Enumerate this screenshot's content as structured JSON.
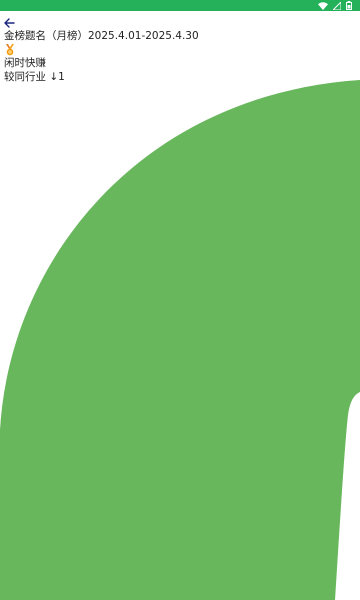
{
  "status_bar": {
    "color": "#24b15a",
    "icons": [
      "wifi-icon",
      "signal-icon",
      "battery-icon"
    ]
  },
  "header": {
    "back_icon": "back-arrow-icon"
  },
  "content": {
    "title": "金榜题名（月榜）2025.4.01-2025.4.30",
    "medal_icon": "medal-icon",
    "app_name": "闲时快赚",
    "rank_compare": "较同行业 ↓1"
  },
  "colors": {
    "accent": "#24b15a",
    "illustration_green": "#64b45a"
  }
}
